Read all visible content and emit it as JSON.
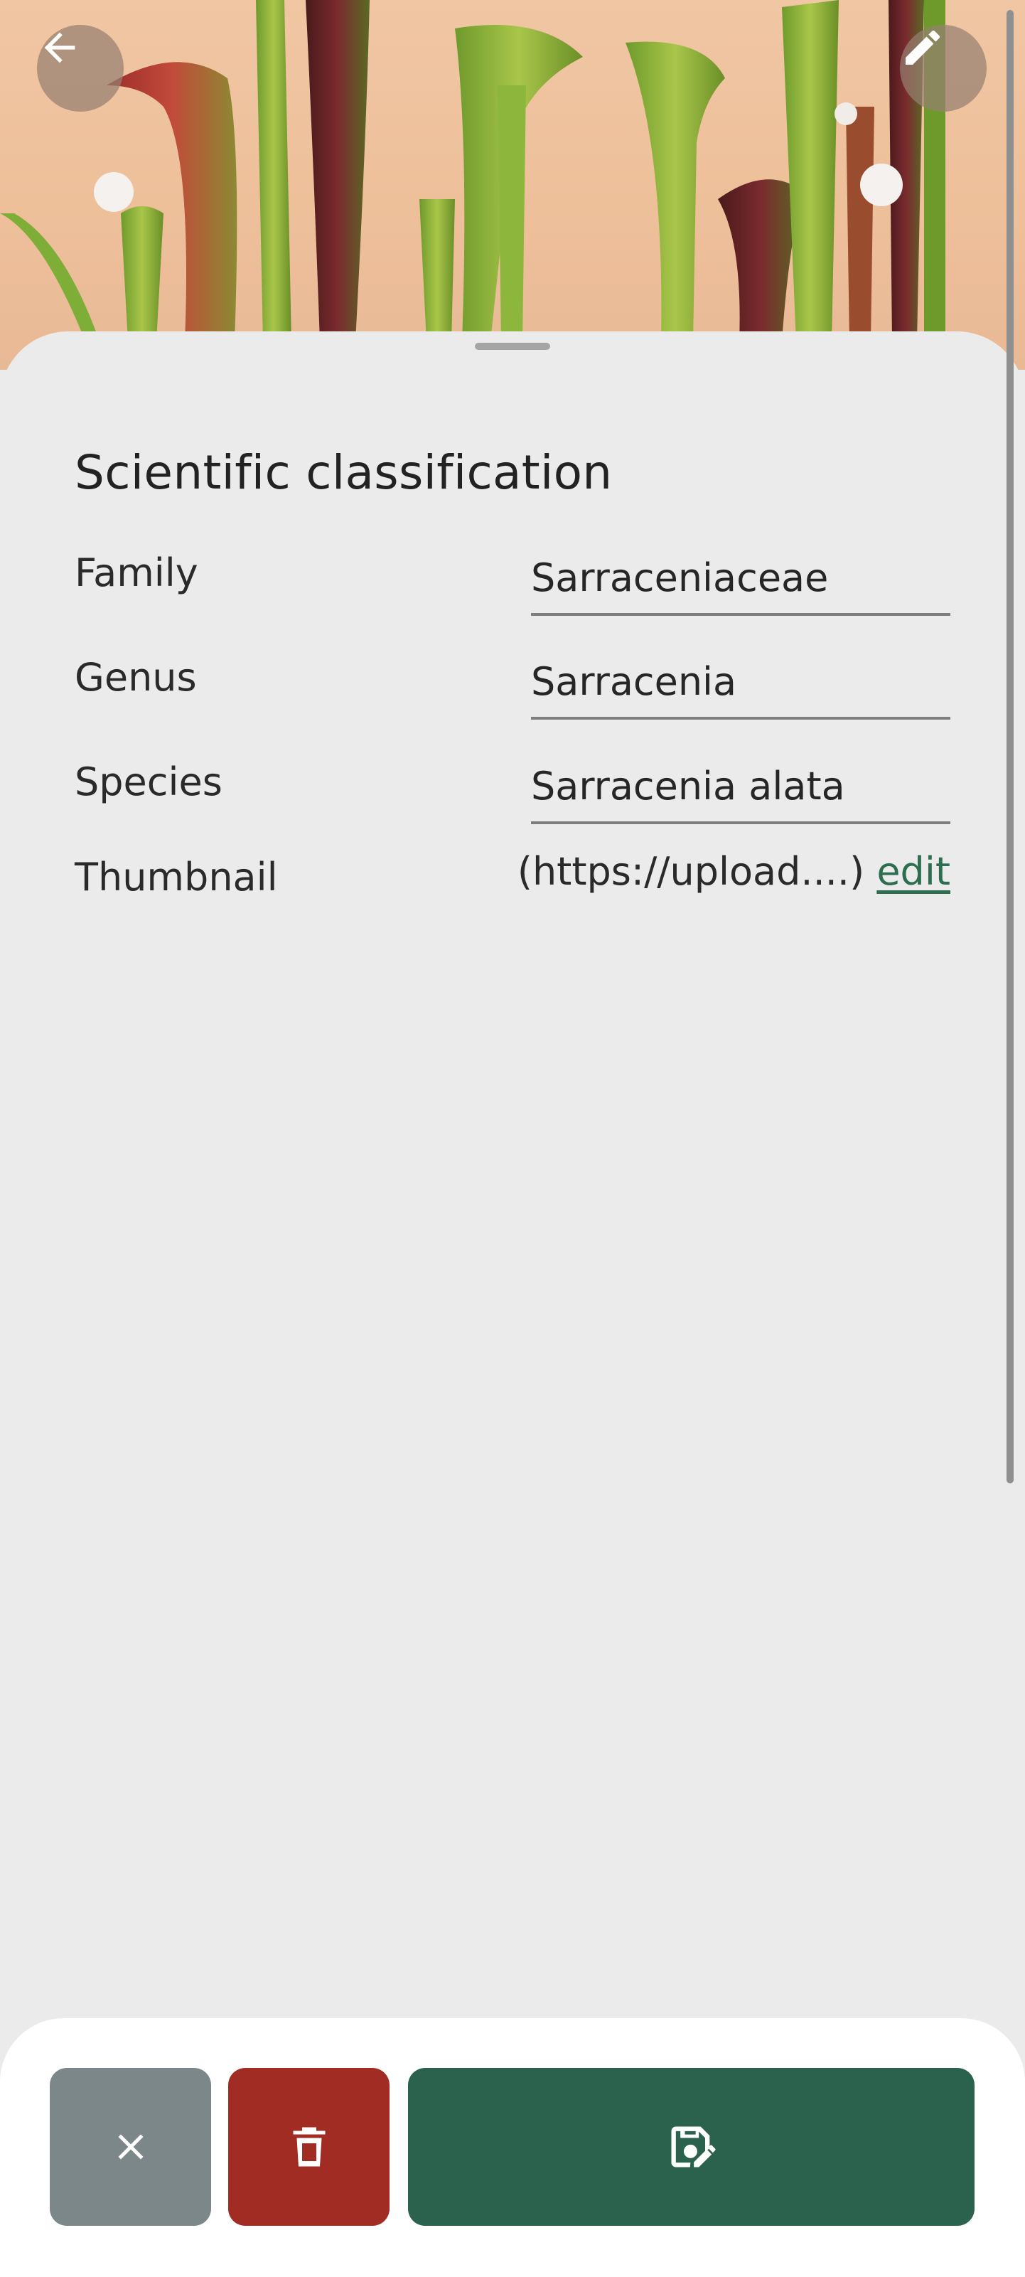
{
  "header": {
    "back_icon": "arrow-left-icon",
    "edit_icon": "pencil-icon"
  },
  "classification": {
    "title": "Scientific classification",
    "rows": [
      {
        "label": "Family",
        "value": "Sarraceniaceae"
      },
      {
        "label": "Genus",
        "value": "Sarracenia"
      },
      {
        "label": "Species",
        "value": "Sarracenia alata"
      }
    ],
    "thumbnail": {
      "label": "Thumbnail",
      "value": "(https://upload....)",
      "edit_label": "edit"
    }
  },
  "actions": {
    "cancel_icon": "close-icon",
    "delete_icon": "trash-icon",
    "save_icon": "save-edit-icon"
  },
  "colors": {
    "accent_green": "#2b624d",
    "delete_red": "#a12c24",
    "cancel_grey": "#7c878a",
    "link_green": "#2e6e50",
    "background": "#ebebeb"
  }
}
